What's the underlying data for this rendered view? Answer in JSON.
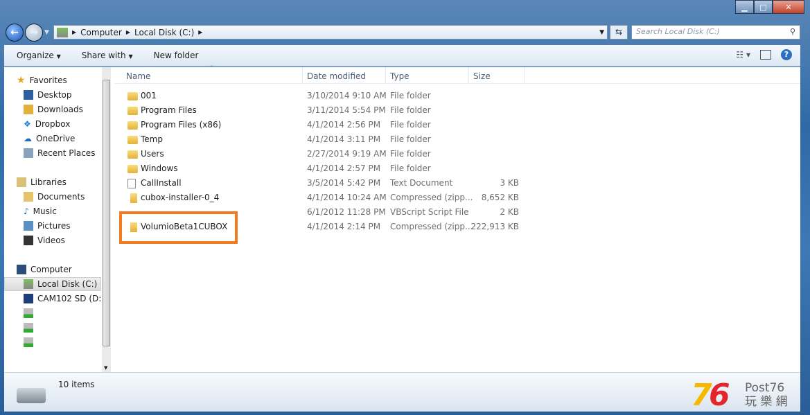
{
  "window": {
    "controls": [
      "minimize",
      "maximize",
      "close"
    ]
  },
  "address": {
    "crumbs": [
      "Computer",
      "Local Disk (C:)"
    ],
    "search_placeholder": "Search Local Disk (C:)"
  },
  "toolbar": {
    "organize": "Organize",
    "share": "Share with",
    "new_folder": "New folder"
  },
  "nav": {
    "favorites": "Favorites",
    "fav_items": [
      "Desktop",
      "Downloads",
      "Dropbox",
      "OneDrive",
      "Recent Places"
    ],
    "libraries": "Libraries",
    "lib_items": [
      "Documents",
      "Music",
      "Pictures",
      "Videos"
    ],
    "computer": "Computer",
    "comp_items": [
      "Local Disk (C:)",
      "CAM102 SD (D:)"
    ]
  },
  "columns": {
    "name": "Name",
    "date": "Date modified",
    "type": "Type",
    "size": "Size"
  },
  "files": [
    {
      "name": "001",
      "date": "3/10/2014 9:10 AM",
      "type": "File folder",
      "size": "",
      "icon": "folder"
    },
    {
      "name": "Program Files",
      "date": "3/11/2014 5:54 PM",
      "type": "File folder",
      "size": "",
      "icon": "folder"
    },
    {
      "name": "Program Files (x86)",
      "date": "4/1/2014 2:56 PM",
      "type": "File folder",
      "size": "",
      "icon": "folder"
    },
    {
      "name": "Temp",
      "date": "4/1/2014 3:11 PM",
      "type": "File folder",
      "size": "",
      "icon": "folder"
    },
    {
      "name": "Users",
      "date": "2/27/2014 9:19 AM",
      "type": "File folder",
      "size": "",
      "icon": "folder"
    },
    {
      "name": "Windows",
      "date": "4/1/2014 2:57 PM",
      "type": "File folder",
      "size": "",
      "icon": "folder"
    },
    {
      "name": "CallInstall",
      "date": "3/5/2014 5:42 PM",
      "type": "Text Document",
      "size": "3 KB",
      "icon": "text"
    },
    {
      "name": "cubox-installer-0_4",
      "date": "4/1/2014 10:24 AM",
      "type": "Compressed (zipp...",
      "size": "8,652 KB",
      "icon": "zip"
    },
    {
      "name": "",
      "date": "6/1/2012 11:28 PM",
      "type": "VBScript Script File",
      "size": "2 KB",
      "icon": "none"
    },
    {
      "name": "VolumioBeta1CUBOX",
      "date": "4/1/2014 2:14 PM",
      "type": "Compressed (zipp...",
      "size": "222,913 KB",
      "icon": "zip"
    }
  ],
  "status": {
    "count": "10 items"
  },
  "highlight_color": "#f47b20",
  "watermark": {
    "text": "Post76 玩樂網",
    "number": "76"
  }
}
